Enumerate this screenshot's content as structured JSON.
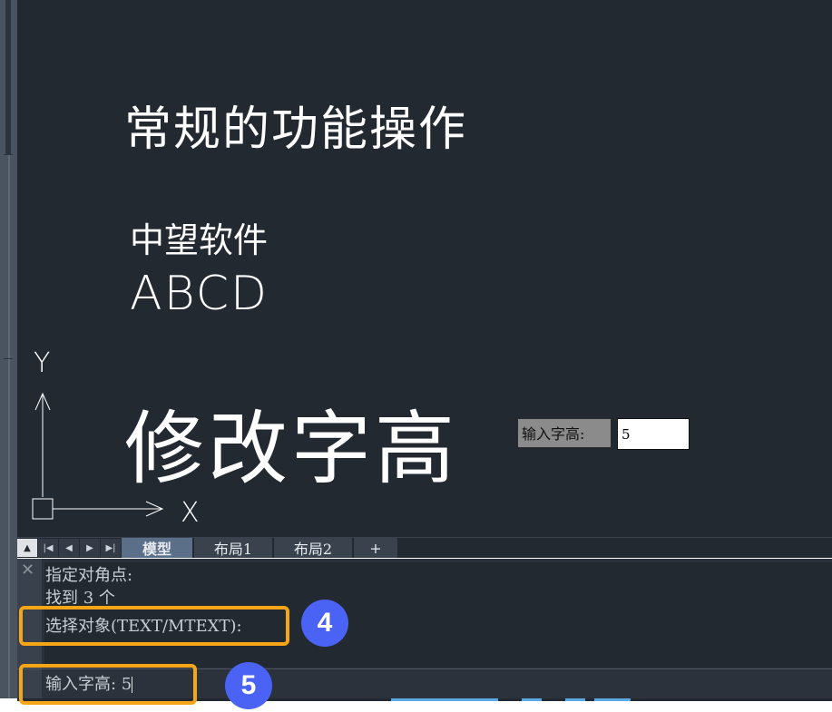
{
  "canvas": {
    "texts": [
      "常规的功能操作",
      "中望软件",
      "ABCD",
      "修改字高"
    ],
    "ucs": {
      "x_label": "X",
      "y_label": "Y"
    },
    "prompt": {
      "label": "输入字高:",
      "value": "5"
    }
  },
  "tabbar": {
    "nav_icons": [
      "scroll-up-icon",
      "first-tab-icon",
      "prev-tab-icon",
      "next-tab-icon",
      "last-tab-icon"
    ],
    "tabs": [
      {
        "label": "模型",
        "active": true
      },
      {
        "label": "布局1",
        "active": false
      },
      {
        "label": "布局2",
        "active": false
      },
      {
        "label": "+",
        "active": false
      }
    ]
  },
  "command": {
    "history": [
      "指定对角点:",
      "找到 3 个",
      "选择对象(TEXT/MTEXT):"
    ],
    "input": "输入字高: 5"
  },
  "annotations": {
    "step4": "4",
    "step5": "5",
    "highlight_color": "#f5a515",
    "badge_color": "#4a63f5"
  },
  "colors": {
    "canvas_bg": "#232931",
    "cad_text": "#ffffff"
  }
}
